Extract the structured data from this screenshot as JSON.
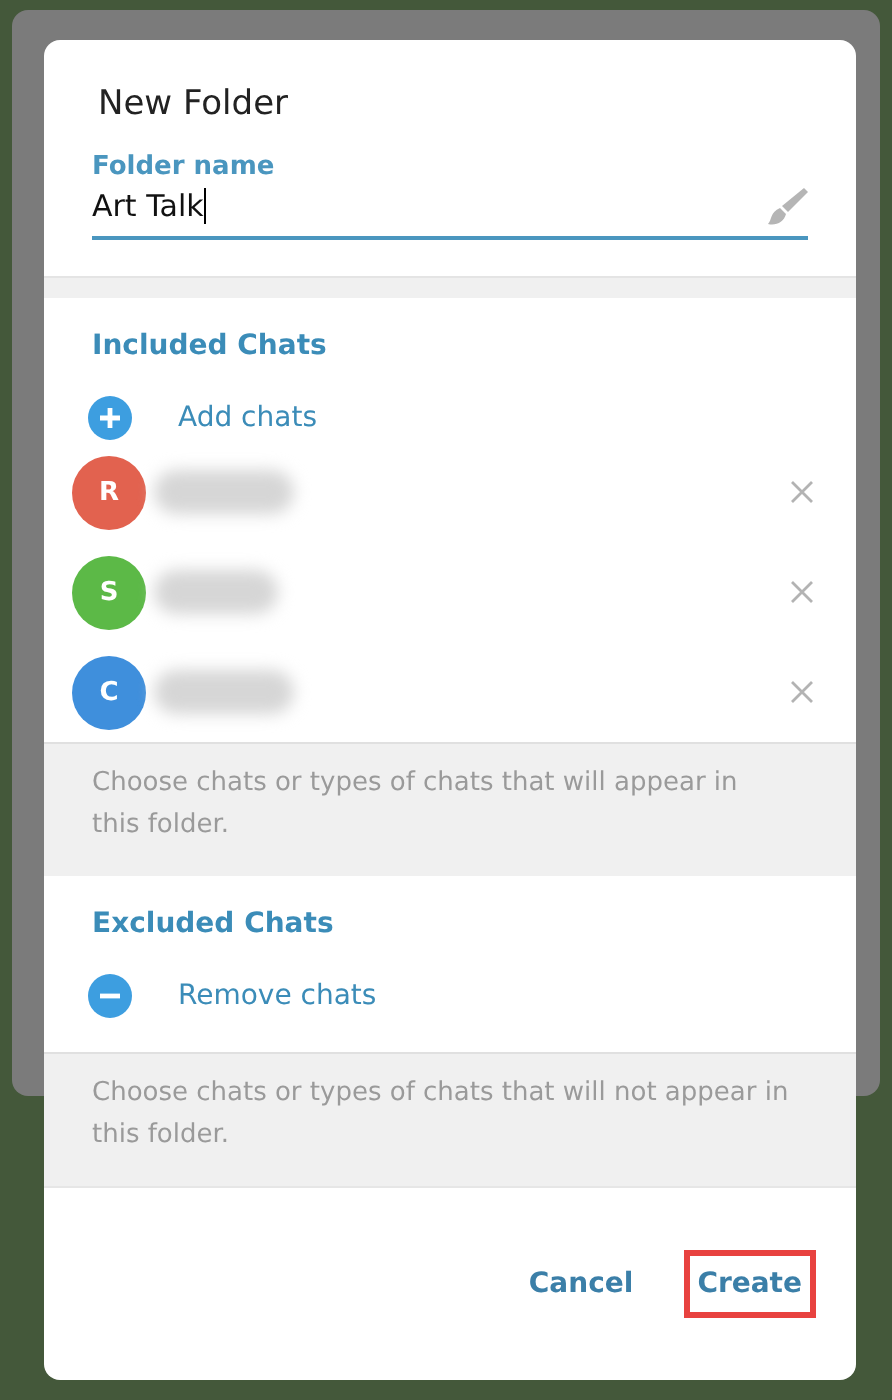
{
  "dialog": {
    "title": "New Folder",
    "name_field": {
      "label": "Folder name",
      "value": "Art Talk",
      "focused": true
    },
    "included": {
      "heading": "Included Chats",
      "add_label": "Add chats",
      "chats": [
        {
          "initial": "R",
          "color": "#e2624f"
        },
        {
          "initial": "S",
          "color": "#5cb947"
        },
        {
          "initial": "C",
          "color": "#3f8fdc"
        }
      ],
      "hint": "Choose chats or types of chats that will appear in this folder."
    },
    "excluded": {
      "heading": "Excluded Chats",
      "remove_label": "Remove chats",
      "hint": "Choose chats or types of chats that will not appear in this folder."
    },
    "buttons": [
      {
        "label": "Cancel",
        "highlighted": false
      },
      {
        "label": "Create",
        "highlighted": true
      }
    ]
  }
}
